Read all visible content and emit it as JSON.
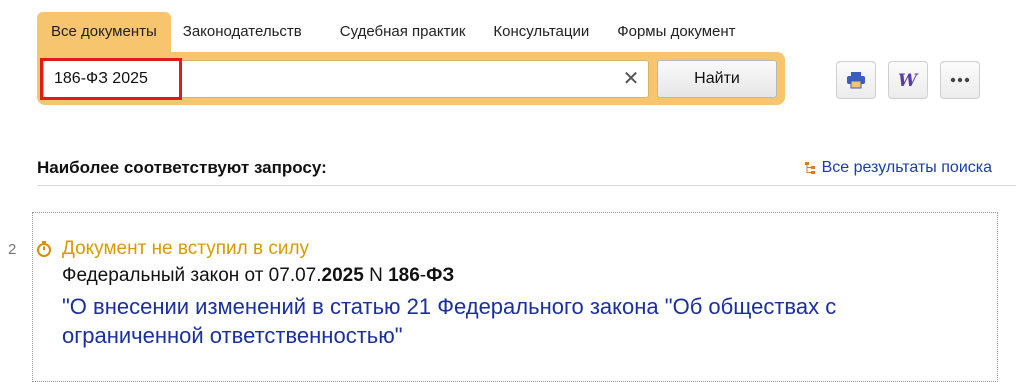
{
  "tabs": [
    {
      "label": "Все документы",
      "active": true
    },
    {
      "label": "Законодательств",
      "active": false
    },
    {
      "label": "Судебная практик",
      "active": false
    },
    {
      "label": "Консультации",
      "active": false
    },
    {
      "label": "Формы документ",
      "active": false
    }
  ],
  "search": {
    "value": "186-ФЗ 2025",
    "clear_icon": "close-icon",
    "submit_label": "Найти"
  },
  "toolbar": {
    "print_icon": "printer-icon",
    "word_icon": "word-icon",
    "more_icon": "more-icon"
  },
  "results_header": {
    "title": "Наиболее соответствуют запросу:",
    "all_results_label": "Все результаты поиска"
  },
  "result": {
    "number": "2",
    "status": "Документ не вступил в силу",
    "meta_prefix": "Федеральный закон от 07.07.",
    "meta_year": "2025",
    "meta_mid": " N ",
    "meta_num": "186",
    "meta_dash": "-",
    "meta_law": "ФЗ",
    "title": "\"О внесении изменений в статью 21 Федерального закона \"Об обществах с ограниченной ответственностью\""
  },
  "colors": {
    "accent": "#f6c56e",
    "status": "#d99a00",
    "link": "#1a2fa0",
    "highlight": "#e11b1b"
  }
}
